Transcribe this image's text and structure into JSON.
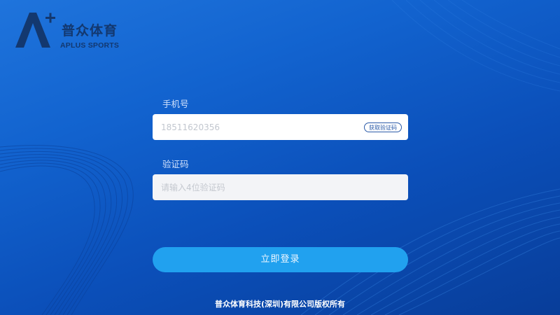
{
  "brand": {
    "name_cn": "普众体育",
    "name_en": "APLUS SPORTS",
    "logo_icon": "a-plus-logo-icon",
    "color": "#13386f"
  },
  "form": {
    "phone": {
      "label": "手机号",
      "value": "18511620356"
    },
    "sms_button_label": "获取验证码",
    "code": {
      "label": "验证码",
      "placeholder": "请输入4位验证码"
    },
    "login_label": "立即登录"
  },
  "footer": {
    "copyright": "普众体育科技(深圳)有限公司版权所有"
  },
  "colors": {
    "background_top": "#1f74dc",
    "background_bottom": "#083d99",
    "login_button": "#21a1ef",
    "sms_button_border": "#2a5aa8"
  }
}
